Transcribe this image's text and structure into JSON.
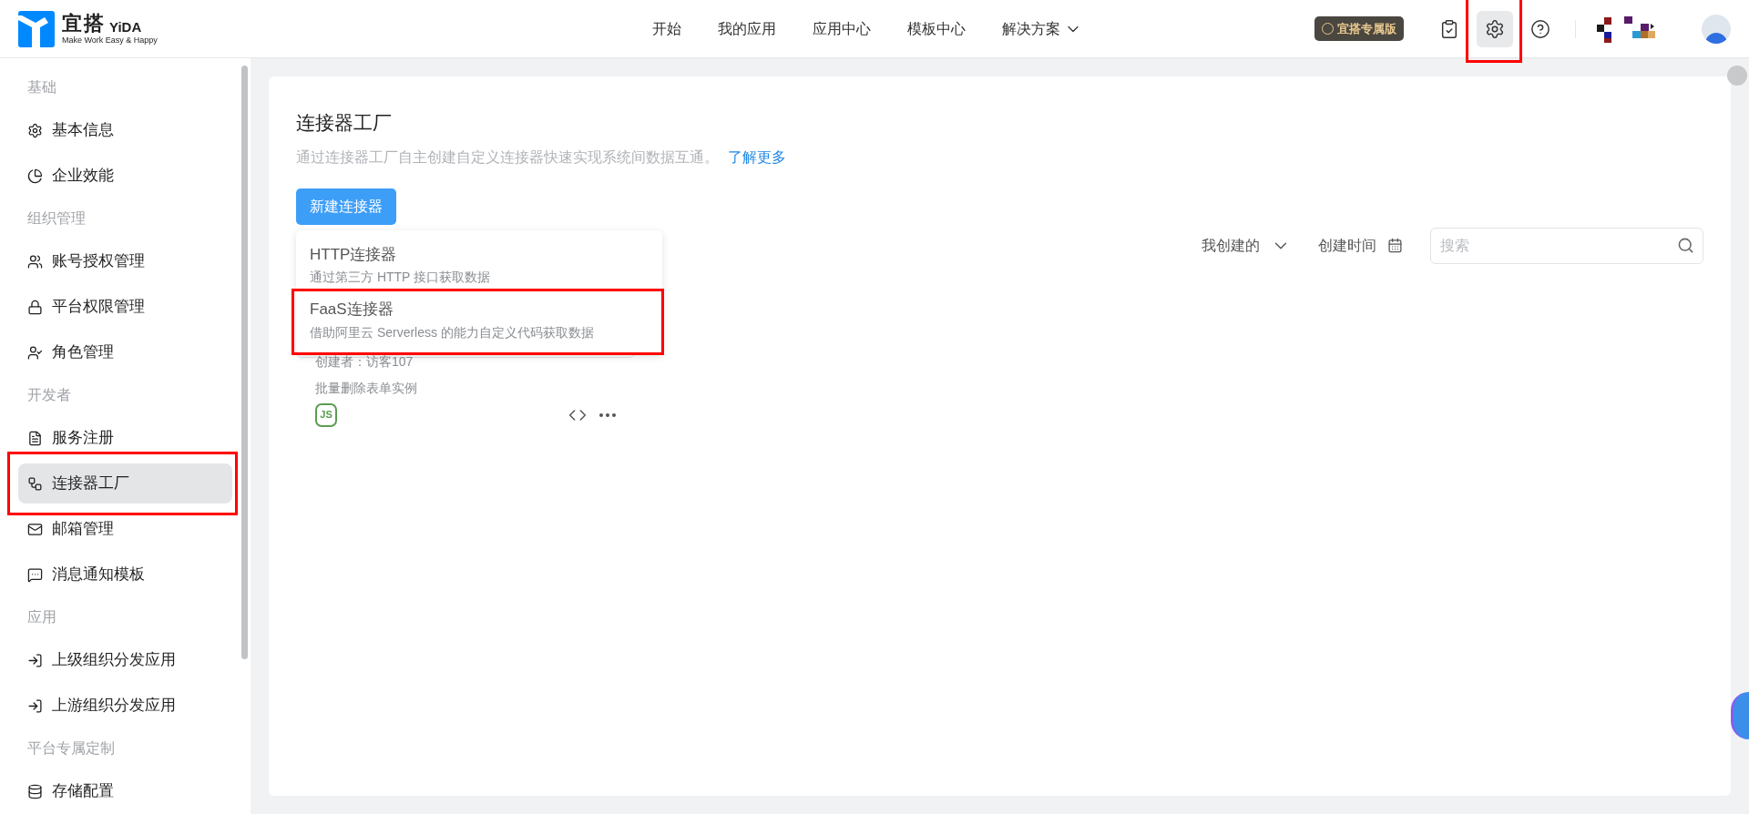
{
  "header": {
    "logo": {
      "name": "宜搭",
      "latin": "YiDA",
      "slogan": "Make Work Easy & Happy"
    },
    "nav": [
      {
        "label": "开始",
        "kind": "link"
      },
      {
        "label": "我的应用",
        "kind": "link"
      },
      {
        "label": "应用中心",
        "kind": "link"
      },
      {
        "label": "模板中心",
        "kind": "link"
      },
      {
        "label": "解决方案",
        "kind": "dropdown"
      }
    ],
    "badge": "宜搭专属版",
    "tools": [
      {
        "selected": false,
        "highlighted": false
      },
      {
        "selected": true,
        "highlighted": true
      },
      {
        "selected": false,
        "highlighted": false
      }
    ]
  },
  "sidebar": {
    "sections": [
      {
        "title": "基础",
        "items": [
          {
            "label": "基本信息",
            "selected": false,
            "highlighted": false
          },
          {
            "label": "企业效能",
            "selected": false,
            "highlighted": false
          }
        ]
      },
      {
        "title": "组织管理",
        "items": [
          {
            "label": "账号授权管理",
            "selected": false,
            "highlighted": false
          },
          {
            "label": "平台权限管理",
            "selected": false,
            "highlighted": false
          },
          {
            "label": "角色管理",
            "selected": false,
            "highlighted": false
          }
        ]
      },
      {
        "title": "开发者",
        "items": [
          {
            "label": "服务注册",
            "selected": false,
            "highlighted": false
          },
          {
            "label": "连接器工厂",
            "selected": true,
            "highlighted": true
          },
          {
            "label": "邮箱管理",
            "selected": false,
            "highlighted": false
          },
          {
            "label": "消息通知模板",
            "selected": false,
            "highlighted": false
          }
        ]
      },
      {
        "title": "应用",
        "items": [
          {
            "label": "上级组织分发应用",
            "selected": false,
            "highlighted": false
          },
          {
            "label": "上游组织分发应用",
            "selected": false,
            "highlighted": false
          }
        ]
      },
      {
        "title": "平台专属定制",
        "items": [
          {
            "label": "存储配置",
            "selected": false,
            "highlighted": false
          }
        ]
      }
    ]
  },
  "page": {
    "title": "连接器工厂",
    "description": "通过连接器工厂自主创建自定义连接器快速实现系统间数据互通。",
    "link": "了解更多",
    "create_button": "新建连接器",
    "menu": [
      {
        "title": "HTTP连接器",
        "subtitle": "通过第三方 HTTP 接口获取数据",
        "highlighted": false
      },
      {
        "title": "FaaS连接器",
        "subtitle": "借助阿里云 Serverless 的能力自定义代码获取数据",
        "highlighted": true
      }
    ],
    "filters": [
      {
        "label": "我创建的",
        "kind": "dropdown"
      },
      {
        "label": "创建时间",
        "kind": "date"
      }
    ],
    "search": {
      "placeholder": "搜索"
    },
    "cards": [
      {
        "creator": "创建者：访客107",
        "description": "批量删除表单实例",
        "runtime": "JS"
      }
    ]
  }
}
